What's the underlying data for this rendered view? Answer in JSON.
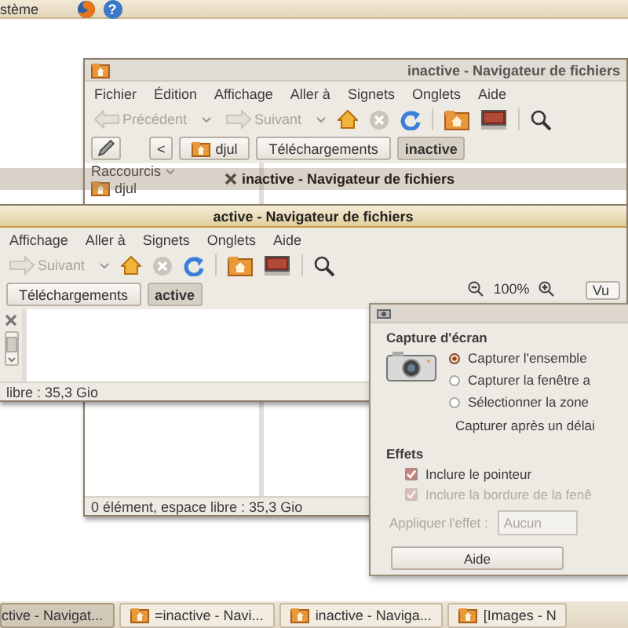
{
  "top_panel": {
    "menu": "stème",
    "help_glyph": "?"
  },
  "windows": [
    {
      "title": "inactive - Navigateur de fichiers",
      "active": false,
      "menu": [
        "Fichier",
        "Édition",
        "Affichage",
        "Aller à",
        "Signets",
        "Onglets",
        "Aide"
      ],
      "toolbar": {
        "back": {
          "label": "Précédent",
          "disabled": true
        },
        "forward": {
          "label": "Suivant",
          "disabled": true
        }
      },
      "path_scroll": "<",
      "path": [
        {
          "label": "djul",
          "selected": false
        },
        {
          "label": "Téléchargements",
          "selected": false
        },
        {
          "label": "inactive",
          "selected": true
        }
      ],
      "sidebar": {
        "header": "Raccourcis",
        "items": [
          "djul"
        ]
      },
      "status": "0 élément, espace libre : 35,3 Gio"
    },
    {
      "title": "active - Navigateur de fichiers",
      "active": true,
      "menu": [
        "Affichage",
        "Aller à",
        "Signets",
        "Onglets",
        "Aide"
      ],
      "toolbar": {
        "forward": {
          "label": "Suivant",
          "disabled": true
        }
      },
      "path": [
        {
          "label": "Téléchargements",
          "selected": false
        },
        {
          "label": "active",
          "selected": true
        }
      ],
      "zoom": "100%",
      "view": "Vu",
      "status": "libre : 35,3 Gio"
    }
  ],
  "drag_ghost": {
    "title": "inactive - Navigateur de fichiers"
  },
  "dialog": {
    "heading": "Capture d'écran",
    "options": [
      {
        "label": "Capturer l'ensemble",
        "selected": true
      },
      {
        "label": "Capturer la fenêtre a",
        "selected": false
      },
      {
        "label": "Sélectionner la zone",
        "selected": false
      }
    ],
    "delay_label": "Capturer après un délai",
    "effects_heading": "Effets",
    "checks": [
      {
        "label": "Inclure le pointeur",
        "checked": true,
        "disabled": false
      },
      {
        "label": "Inclure la bordure de la fenê",
        "checked": true,
        "disabled": true
      }
    ],
    "effect": {
      "label": "Appliquer l'effet :",
      "value": "Aucun",
      "disabled": true
    },
    "buttons": [
      "Aide"
    ]
  },
  "taskbar": [
    {
      "label": "ctive - Navigat...",
      "selected": true
    },
    {
      "label": "=inactive - Navi...",
      "selected": false
    },
    {
      "label": "inactive - Naviga...",
      "selected": false
    },
    {
      "label": "[Images - N",
      "selected": false
    }
  ]
}
